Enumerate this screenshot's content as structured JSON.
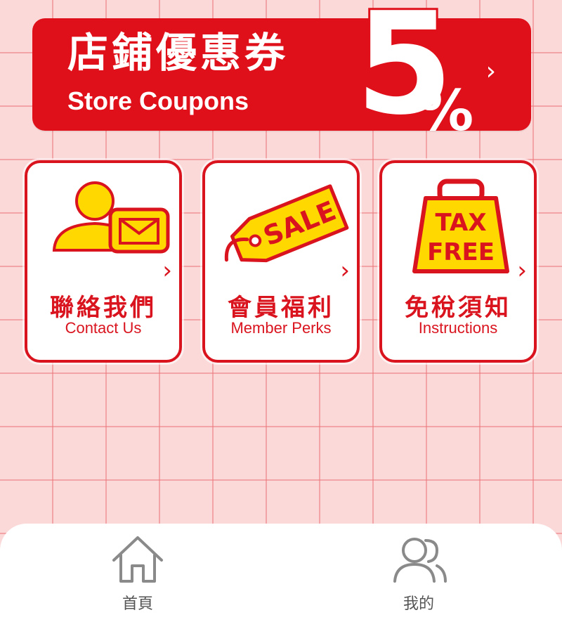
{
  "banner": {
    "title_zh": "店鋪優惠券",
    "title_en": "Store Coupons",
    "discount_number": "5",
    "discount_symbol": "%",
    "arrow": "›"
  },
  "cards": [
    {
      "title_zh": "聯絡我們",
      "title_en": "Contact Us",
      "icon": "contact-mail-icon",
      "arrow": "›"
    },
    {
      "title_zh": "會員福利",
      "title_en": "Member Perks",
      "icon": "sale-tag-icon",
      "icon_text": "SALE",
      "arrow": "›"
    },
    {
      "title_zh": "免稅須知",
      "title_en": "Instructions",
      "icon": "tax-free-bag-icon",
      "icon_text_1": "TAX",
      "icon_text_2": "FREE",
      "arrow": "›"
    }
  ],
  "tabbar": {
    "home": {
      "label": "首頁",
      "icon": "home-icon"
    },
    "mine": {
      "label": "我的",
      "icon": "users-icon"
    }
  },
  "colors": {
    "brand_red": "#e0101b",
    "card_border": "#d9141e",
    "icon_yellow": "#ffd800",
    "background_pink": "#fbd9d9"
  }
}
